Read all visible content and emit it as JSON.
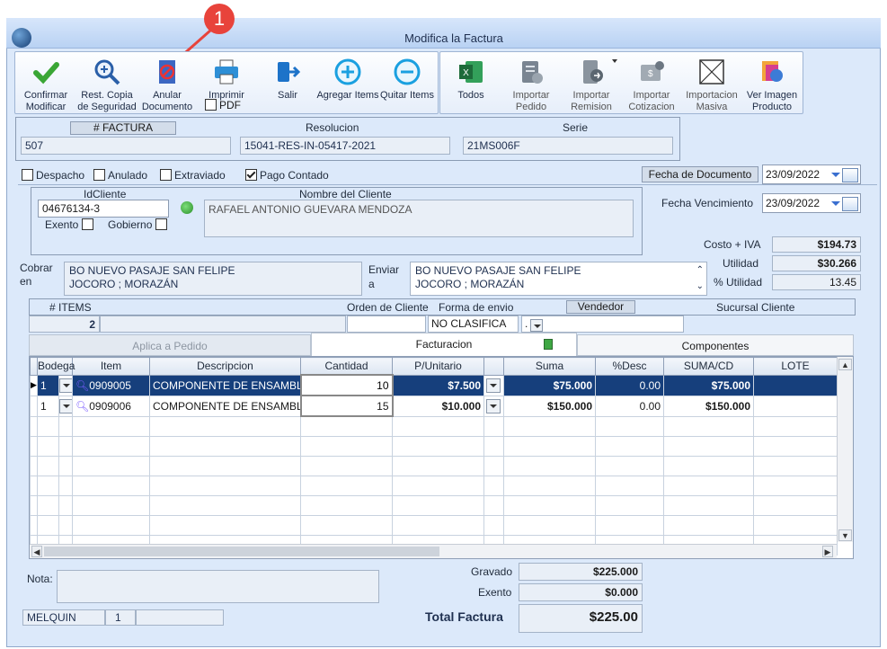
{
  "window": {
    "title": "Modifica la Factura"
  },
  "annotation": {
    "marker": "1"
  },
  "toolbar": {
    "confirm": "Confirmar Modificar",
    "backup": "Rest. Copia de Seguridad",
    "void": "Anular Documento",
    "print": "Imprimir",
    "pdf": "PDF",
    "exit": "Salir",
    "add": "Agregar Items",
    "remove": "Quitar Items",
    "all": "Todos",
    "import_order": "Importar Pedido",
    "import_remission": "Importar Remision",
    "import_quote": "Importar Cotizacion",
    "mass_import": "Importacion Masiva",
    "view_image": "Ver Imagen Producto"
  },
  "header": {
    "factura_label": "# FACTURA",
    "factura": "507",
    "resolucion_label": "Resolucion",
    "resolucion": "15041-RES-IN-05417-2021",
    "serie_label": "Serie",
    "serie": "21MS006F"
  },
  "flags": {
    "despacho": "Despacho",
    "anulado": "Anulado",
    "extraviado": "Extraviado",
    "pago_contado": "Pago Contado"
  },
  "dates": {
    "doc_label": "Fecha de  Documento",
    "doc": "23/09/2022",
    "venc_label": "Fecha Vencimiento",
    "venc": "23/09/2022"
  },
  "client": {
    "id_label": "IdCliente",
    "id": "04676134-3",
    "name_label": "Nombre del Cliente",
    "name": "RAFAEL ANTONIO GUEVARA MENDOZA",
    "exento": "Exento",
    "gobierno": "Gobierno"
  },
  "costs": {
    "costo_label": "Costo + IVA",
    "costo": "$194.73",
    "utilidad_label": "Utilidad",
    "utilidad": "$30.266",
    "pct_label": "% Utilidad",
    "pct": "13.45"
  },
  "address": {
    "cobrar_label1": "Cobrar",
    "cobrar_label2": "en",
    "cobrar_line1": "BO NUEVO PASAJE SAN FELIPE",
    "cobrar_line2": "JOCORO ; MORAZÁN",
    "enviar_label1": "Enviar",
    "enviar_label2": "a",
    "enviar_line1": "BO NUEVO PASAJE SAN FELIPE",
    "enviar_line2": "JOCORO ; MORAZÁN"
  },
  "info": {
    "items_label": "# ITEMS",
    "items": "2",
    "orden_label": "Orden de Cliente",
    "forma_label": "Forma de envio",
    "forma": "NO CLASIFICA",
    "vendedor_label": "Vendedor",
    "vendedor": ".",
    "sucursal_label": "Sucursal Cliente"
  },
  "tabs": {
    "pedido": "Aplica a Pedido",
    "facturacion": "Facturacion",
    "componentes": "Componentes"
  },
  "grid": {
    "columns": [
      "Bodega",
      "Item",
      "Descripcion",
      "Cantidad",
      "P/Unitario",
      "Suma",
      "%Desc",
      "SUMA/CD",
      "LOTE"
    ],
    "rows": [
      {
        "bodega": "1",
        "item": "0909005",
        "desc": "COMPONENTE DE ENSAMBL",
        "cant": "10",
        "precio": "$7.500",
        "suma": "$75.000",
        "desc_pct": "0.00",
        "sumacd": "$75.000"
      },
      {
        "bodega": "1",
        "item": "0909006",
        "desc": "COMPONENTE DE ENSAMBL",
        "cant": "15",
        "precio": "$10.000",
        "suma": "$150.000",
        "desc_pct": "0.00",
        "sumacd": "$150.000"
      }
    ]
  },
  "footer": {
    "nota_label": "Nota:",
    "user": "MELQUIN",
    "user_num": "1",
    "gravado_label": "Gravado",
    "gravado": "$225.000",
    "exento_label": "Exento",
    "exento": "$0.000",
    "total_label": "Total Factura",
    "total": "$225.00"
  },
  "colors": {
    "accent": "#163f7c",
    "annotation": "#e8433b"
  }
}
